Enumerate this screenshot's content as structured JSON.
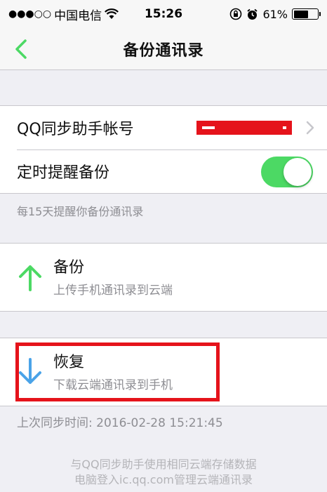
{
  "status_bar": {
    "carrier": "中国电信",
    "time": "15:26",
    "battery": "61%",
    "battery_level": 0.61
  },
  "nav": {
    "title": "备份通讯录"
  },
  "settings": {
    "account_label": "QQ同步助手帐号",
    "reminder_label": "定时提醒备份",
    "reminder_on": true,
    "reminder_hint": "每15天提醒你备份通讯录"
  },
  "backup": {
    "title": "备份",
    "subtitle": "上传手机通讯录到云端"
  },
  "restore": {
    "title": "恢复",
    "subtitle": "下载云端通讯录到手机"
  },
  "last_sync": "上次同步时间: 2016-02-28 15:21:45",
  "footer": {
    "line1": "与QQ同步助手使用相同云端存储数据",
    "line2": "电脑登入ic.qq.com管理云端通讯录"
  },
  "colors": {
    "accent_green": "#4cd964",
    "icon_green": "#4cd964",
    "icon_blue": "#4aa3e8",
    "highlight_red": "#e5131b"
  }
}
